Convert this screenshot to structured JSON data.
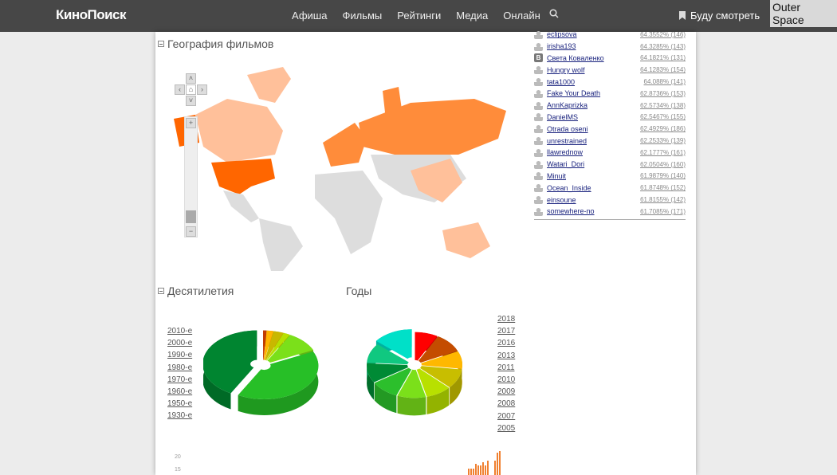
{
  "header": {
    "logo": "КиноПоиск",
    "nav": [
      "Афиша",
      "Фильмы",
      "Рейтинги",
      "Медиа",
      "Онлайн"
    ],
    "search_icon": "search-icon",
    "watchlist": "Буду смотреть",
    "tooltip": "Outer Space"
  },
  "users": [
    {
      "name": "eclipsova",
      "value": "64.3552% (146)",
      "avatar": "default"
    },
    {
      "name": "irisha193",
      "value": "64.3285% (143)",
      "avatar": "default"
    },
    {
      "name": "Света Коваленко",
      "value": "64.1821% (131)",
      "avatar": "B"
    },
    {
      "name": "Hungry wolf",
      "value": "64.1283% (154)",
      "avatar": "default"
    },
    {
      "name": "tata1000",
      "value": "64.088% (141)",
      "avatar": "default"
    },
    {
      "name": "Fake Your Death",
      "value": "62.8736% (153)",
      "avatar": "default"
    },
    {
      "name": "AnnKaprizka",
      "value": "62.5734% (138)",
      "avatar": "default"
    },
    {
      "name": "DanielMS",
      "value": "62.5467% (155)",
      "avatar": "default"
    },
    {
      "name": "Otrada oseni",
      "value": "62.4929% (186)",
      "avatar": "default"
    },
    {
      "name": "unrestrained",
      "value": "62.2533% (139)",
      "avatar": "default"
    },
    {
      "name": "llawrednow",
      "value": "62.1777% (161)",
      "avatar": "default"
    },
    {
      "name": "Watari_Dori",
      "value": "62.0504% (160)",
      "avatar": "default"
    },
    {
      "name": "Minuit",
      "value": "61.9879% (140)",
      "avatar": "default"
    },
    {
      "name": "Ocean_Inside",
      "value": "61.8748% (152)",
      "avatar": "default"
    },
    {
      "name": "einsoune",
      "value": "61.8155% (142)",
      "avatar": "default"
    },
    {
      "name": "somewhere-no",
      "value": "61.7085% (171)",
      "avatar": "default"
    }
  ],
  "geo": {
    "title": "География фильмов",
    "colors": {
      "high": "#ff6600",
      "mid": "#ff8c3a",
      "low": "#ffc09a",
      "none": "#dddddd"
    }
  },
  "decades": {
    "title": "Десятилетия",
    "labels": [
      "2010-е",
      "2000-е",
      "1990-е",
      "1980-е",
      "1970-е",
      "1960-е",
      "1950-е",
      "1930-е"
    ]
  },
  "years": {
    "title": "Годы",
    "labels": [
      "2018",
      "2017",
      "2016",
      "2013",
      "2011",
      "2010",
      "2009",
      "2008",
      "2007",
      "2005"
    ]
  },
  "chart_data": [
    {
      "type": "pie",
      "title": "Десятилетия",
      "categories": [
        "1930-е",
        "1950-е",
        "1960-е",
        "1970-е",
        "1980-е",
        "1990-е",
        "2000-е",
        "2010-е"
      ],
      "values": [
        1,
        2,
        3,
        2,
        10,
        40,
        0,
        42
      ],
      "colors": [
        "#c23b00",
        "#ffb400",
        "#c8b800",
        "#b8e000",
        "#7be01a",
        "#27bf27",
        "#1a9f2a",
        "#008530"
      ]
    },
    {
      "type": "pie",
      "title": "Годы",
      "categories": [
        "2005",
        "2007",
        "2008",
        "2009",
        "2010",
        "2011",
        "2013",
        "2016",
        "2017",
        "2018"
      ],
      "values": [
        8,
        10,
        9,
        10,
        9,
        10,
        10,
        10,
        10,
        14
      ],
      "colors": [
        "#ff0000",
        "#c44c00",
        "#ffb800",
        "#c8be00",
        "#b8e000",
        "#7be01a",
        "#2cbf2c",
        "#008a35",
        "#10c880",
        "#00e0c8"
      ]
    },
    {
      "type": "bar",
      "yticks": [
        15,
        20
      ]
    }
  ]
}
